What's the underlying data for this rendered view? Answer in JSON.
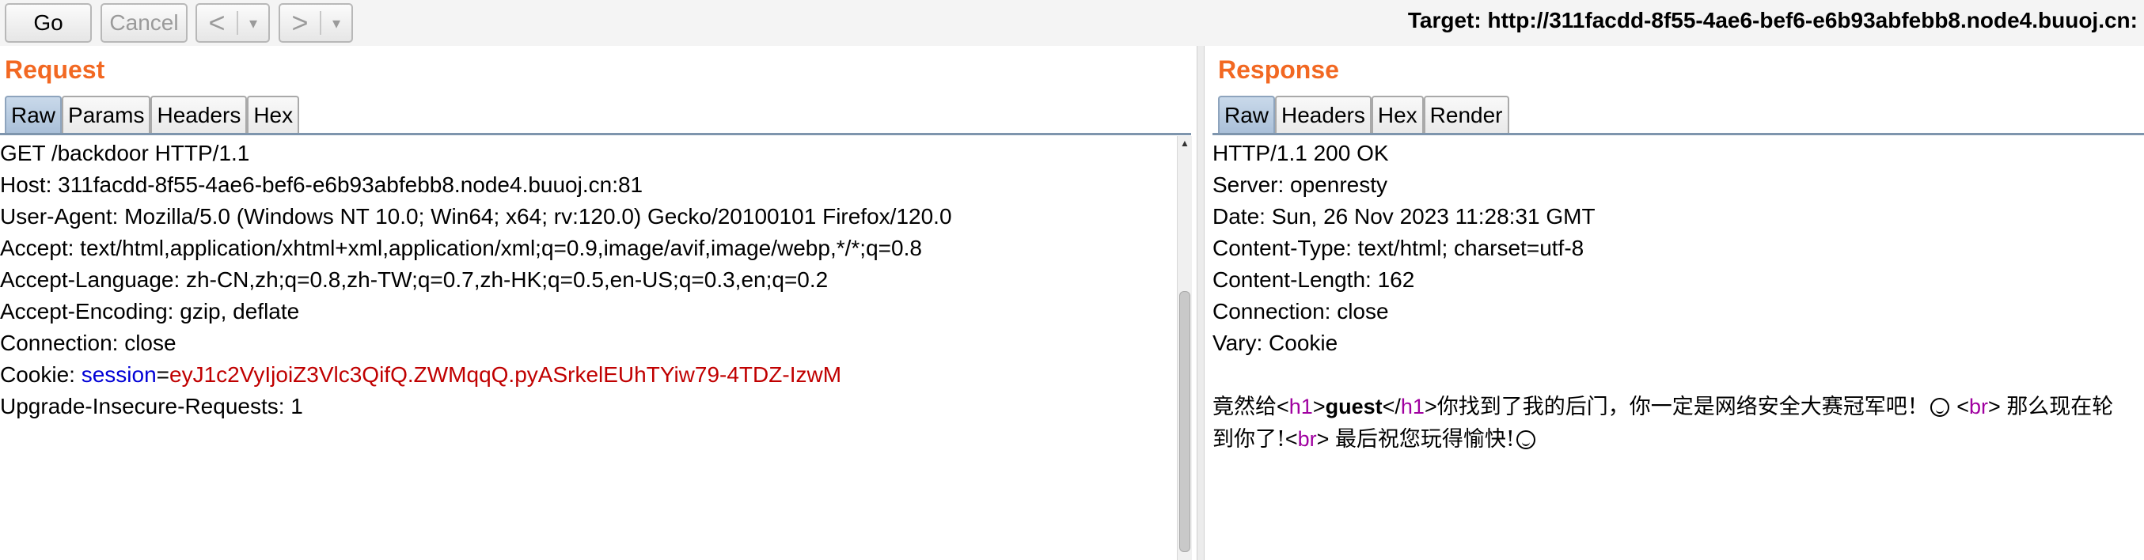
{
  "toolbar": {
    "go_label": "Go",
    "cancel_label": "Cancel",
    "back_icon": "<",
    "forward_icon": ">",
    "dropdown_icon": "▾",
    "target": "Target: http://311facdd-8f55-4ae6-bef6-e6b93abfebb8.node4.buuoj.cn:"
  },
  "request": {
    "title": "Request",
    "tabs": [
      "Raw",
      "Params",
      "Headers",
      "Hex"
    ],
    "active_tab": "Raw",
    "lines": [
      "GET /backdoor HTTP/1.1",
      "Host: 311facdd-8f55-4ae6-bef6-e6b93abfebb8.node4.buuoj.cn:81",
      "User-Agent: Mozilla/5.0 (Windows NT 10.0; Win64; x64; rv:120.0) Gecko/20100101 Firefox/120.0",
      "Accept: text/html,application/xhtml+xml,application/xml;q=0.9,image/avif,image/webp,*/*;q=0.8",
      "Accept-Language: zh-CN,zh;q=0.8,zh-TW;q=0.7,zh-HK;q=0.5,en-US;q=0.3,en;q=0.2",
      "Accept-Encoding: gzip, deflate",
      "Connection: close"
    ],
    "cookie_prefix": "Cookie: ",
    "cookie_name": "session",
    "cookie_eq": "=",
    "cookie_value": "eyJ1c2VyIjoiZ3Vlc3QifQ.ZWMqqQ.pyASrkelEUhTYiw79-4TDZ-IzwM",
    "last_line": "Upgrade-Insecure-Requests: 1"
  },
  "response": {
    "title": "Response",
    "tabs": [
      "Raw",
      "Headers",
      "Hex",
      "Render"
    ],
    "active_tab": "Raw",
    "lines": [
      "HTTP/1.1 200 OK",
      "Server: openresty",
      "Date: Sun, 26 Nov 2023 11:28:31 GMT",
      "Content-Type: text/html; charset=utf-8",
      "Content-Length: 162",
      "Connection: close",
      "Vary: Cookie"
    ],
    "body": {
      "part1": "竟然给",
      "lt": "<",
      "h1_open": "h1",
      "gt": ">",
      "guest": "guest",
      "lt_slash": "</",
      "h1_close": "h1",
      "gt2": ">",
      "part2": "你找到了我的后门，你一定是网络安全大赛冠军吧！",
      "lt3": " <",
      "br1": "br",
      "gt3": "> ",
      "part3": "那么现在轮到你了!",
      "lt4": "<",
      "br2": "br",
      "gt4": "> ",
      "part4": "最后祝您玩得愉快!"
    }
  },
  "colors": {
    "title": "#f26822",
    "cookie_name": "#0000d6",
    "cookie_value": "#c00000",
    "html_tag": "#a000a0"
  }
}
